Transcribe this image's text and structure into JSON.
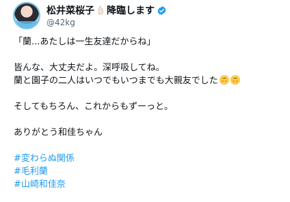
{
  "author": {
    "name": "松井菜桜子",
    "name_suffix": "降臨します",
    "handle": "@42kg",
    "verified": true,
    "icons": [
      "raised-hand-icon",
      "verified-badge-icon"
    ]
  },
  "post": {
    "quote": "「蘭...あたしは一生友達だからね」",
    "p1_line1": "皆んな、大丈夫だよ。深呼吸してね。",
    "p1_line2": "蘭と園子の二人はいつでもいつまでも大親友でした",
    "p1_line2_emojis": [
      "smiling-face-icon",
      "smiling-face-icon"
    ],
    "p2": "そしてもちろん、これからもずーっと。",
    "p3": "ありがとう和佳ちゃん",
    "hashtags": [
      "#変わらぬ関係",
      "#毛利蘭",
      "#山崎和佳奈"
    ]
  },
  "colors": {
    "link": "#1d9bf0",
    "text": "#0f1419",
    "secondary": "#536471",
    "verified": "#1d9bf0"
  }
}
